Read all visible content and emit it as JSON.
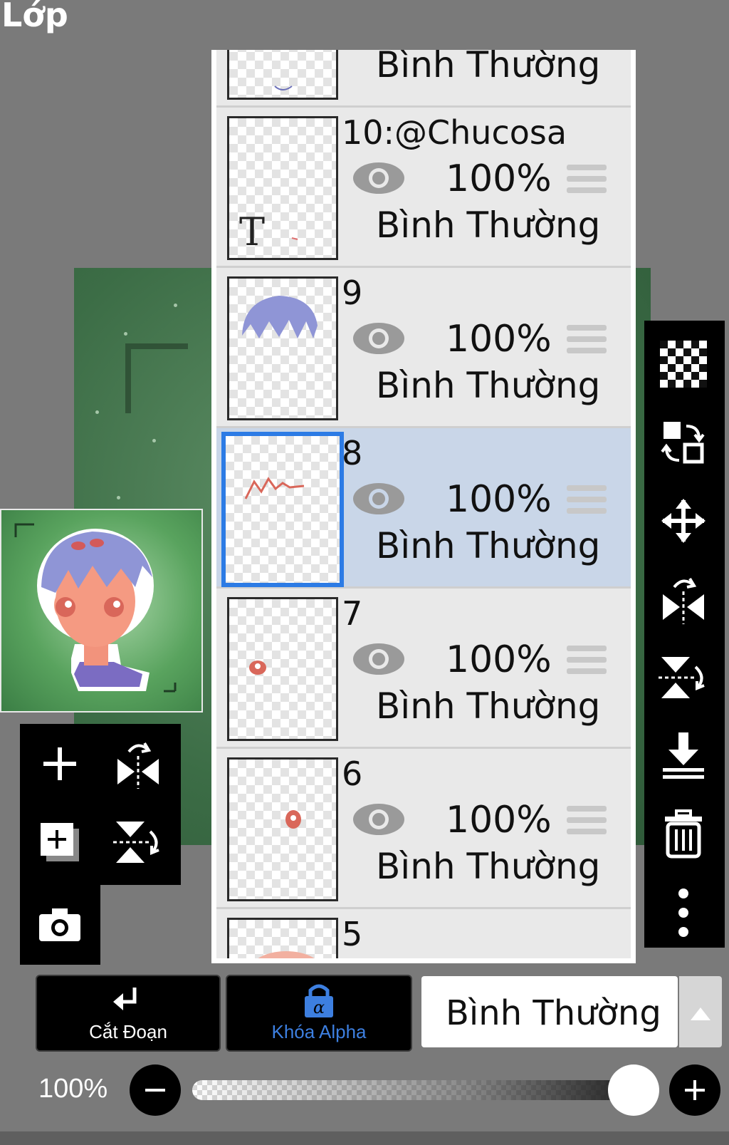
{
  "header": {
    "title": "Lớp"
  },
  "layers": [
    {
      "name": "",
      "opacity": "",
      "blend_mode": "Bình Thường",
      "selected": false
    },
    {
      "name": "10:@Chucosa",
      "opacity": "100%",
      "blend_mode": "Bình Thường",
      "selected": false,
      "thumb_text": "T"
    },
    {
      "name": "9",
      "opacity": "100%",
      "blend_mode": "Bình Thường",
      "selected": false
    },
    {
      "name": "8",
      "opacity": "100%",
      "blend_mode": "Bình Thường",
      "selected": true
    },
    {
      "name": "7",
      "opacity": "100%",
      "blend_mode": "Bình Thường",
      "selected": false
    },
    {
      "name": "6",
      "opacity": "100%",
      "blend_mode": "Bình Thường",
      "selected": false
    },
    {
      "name": "5",
      "opacity": "",
      "blend_mode": "",
      "selected": false
    }
  ],
  "right_toolbar": [
    "transparency-icon",
    "swap-layers-icon",
    "move-icon",
    "flip-horizontal-icon",
    "flip-vertical-icon",
    "merge-down-icon",
    "trash-icon",
    "more-icon"
  ],
  "left_toolbar": [
    "add-layer-icon",
    "flip-horizontal-icon",
    "add-copy-layer-icon",
    "flip-vertical-icon",
    "camera-icon"
  ],
  "bottom": {
    "clip_label": "Cắt Đoạn",
    "alpha_lock_label": "Khóa Alpha",
    "blend_mode_value": "Bình Thường",
    "opacity_label": "100%",
    "opacity_value": 1.0
  },
  "colors": {
    "selected_border": "#2c7be5",
    "selected_bg": "#c9d6e8",
    "alpha_lock": "#3d7fe0"
  }
}
